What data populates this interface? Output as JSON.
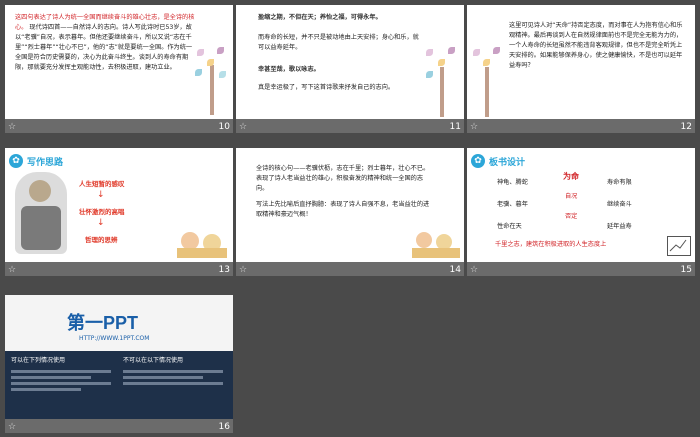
{
  "slides": [
    {
      "num": "10",
      "text": "现代诗四首——自然诗人的志向。诗人写此诗时已53岁，故以“老骥”自况，表示暮年。但他还要继续奋斗，所以又说“志在千里”“烈士暮年”“壮心不已”，他的“志”就是要统一全国。作为统一全国是符合历史需要的，决心为此奋斗终生。谈到人的寿命有期限，那就要充分发挥主观能动性，去积极进取，建功立业。",
      "red": "这四句表达了诗人为统一全国而继续奋斗的雄心壮志，是全诗的核心。"
    },
    {
      "num": "11",
      "lines": [
        "盈缩之期，不但在天；养怡之福，可得永年。",
        "而寿命的长短，并不只是被动地由上天安排；身心和乐，就可以益寿延年。",
        "幸甚至哉，歌以咏志。",
        "真是幸运极了，写下这首诗歌来抒发自己的志向。"
      ]
    },
    {
      "num": "12",
      "text": "这里可见诗人对“天命”持否定态度，而对事在人为抱有信心和乐观精神。最后再谈到人在自然规律面前也不是完全无能为力的，一个人寿命的长短虽然不能违背客观规律，但也不是完全听凭上天安排的。如果能够保养身心，使之健康愉快，不是也可以延年益寿吗？"
    },
    {
      "num": "13",
      "title": "写作思路",
      "items": [
        "人生短暂的感叹",
        "壮怀激烈的高唱",
        "哲理的思辨"
      ]
    },
    {
      "num": "14",
      "text1": "全诗的核心句——老骥伏枥，志在千里；烈士暮年，壮心不已。表现了诗人老当益壮的雄心，积极奋发的精神和统一全国的志向。",
      "text2": "写法上先比喻后直抒胸臆：表现了诗人自强不息，老当益壮的进取精神和豪迈气概！"
    },
    {
      "num": "15",
      "title": "板书设计",
      "nodes": [
        "神龟、腾蛇",
        "寿命有限",
        "老骥、暮年",
        "继续奋斗",
        "性命在天",
        "延年益寿",
        "为命",
        "自况",
        "否定"
      ],
      "bottom": "千里之志，建筑在积极进取的人生态度上"
    },
    {
      "num": "16",
      "logo": "第一PPT",
      "url": "HTTP://WWW.1PPT.COM",
      "left_title": "可以在下列情况使用",
      "right_title": "不可以在以下情况使用"
    }
  ]
}
